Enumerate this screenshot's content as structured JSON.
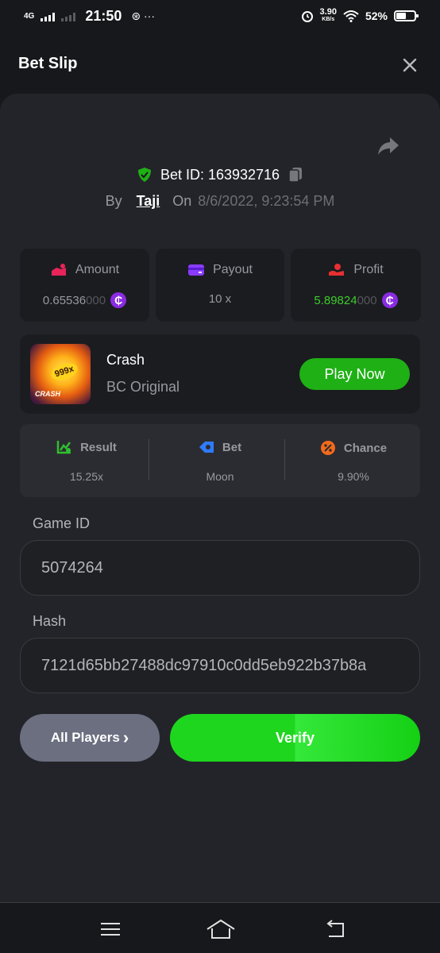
{
  "status_bar": {
    "network": "4G",
    "time": "21:50",
    "extra_icons": "⊛ ···",
    "speed_value": "3.90",
    "speed_unit": "KB/s",
    "battery": "52%"
  },
  "header": {
    "title": "Bet Slip",
    "close_icon": "close-icon"
  },
  "bet": {
    "bet_id_label": "Bet ID: 163932716",
    "by_label": "By",
    "user": "Taji",
    "on_label": "On",
    "date": "8/6/2022, 9:23:54 PM"
  },
  "stats": [
    {
      "label": "Amount",
      "value_main": "0.65536",
      "value_dim": "000",
      "icon": "amount-icon"
    },
    {
      "label": "Payout",
      "value_main": "10 x",
      "icon": "payout-icon"
    },
    {
      "label": "Profit",
      "value_main": "5.89824",
      "value_dim": "000",
      "icon": "profit-icon"
    }
  ],
  "coin_symbol": "₵",
  "game": {
    "name": "Crash",
    "subtitle": "BC Original",
    "thumb_badge": "999x",
    "thumb_label": "CRASH",
    "play_label": "Play Now"
  },
  "result": [
    {
      "label": "Result",
      "value": "15.25x",
      "icon": "result-chart-icon"
    },
    {
      "label": "Bet",
      "value": "Moon",
      "icon": "bet-tag-icon"
    },
    {
      "label": "Chance",
      "value": "9.90%",
      "icon": "percent-icon"
    }
  ],
  "game_id": {
    "label": "Game ID",
    "value": "5074264"
  },
  "hash": {
    "label": "Hash",
    "value": "7121d65bb27488dc97910c0dd5eb922b37b8a"
  },
  "actions": {
    "all_players": "All Players",
    "all_players_chevron": "›",
    "verify": "Verify"
  },
  "colors": {
    "background": "#17181b",
    "card": "#232429",
    "green": "#1fb016",
    "verify_green": "#1ed61e",
    "profit_green": "#3dcc2b",
    "coin_purple": "#8a2be2"
  }
}
